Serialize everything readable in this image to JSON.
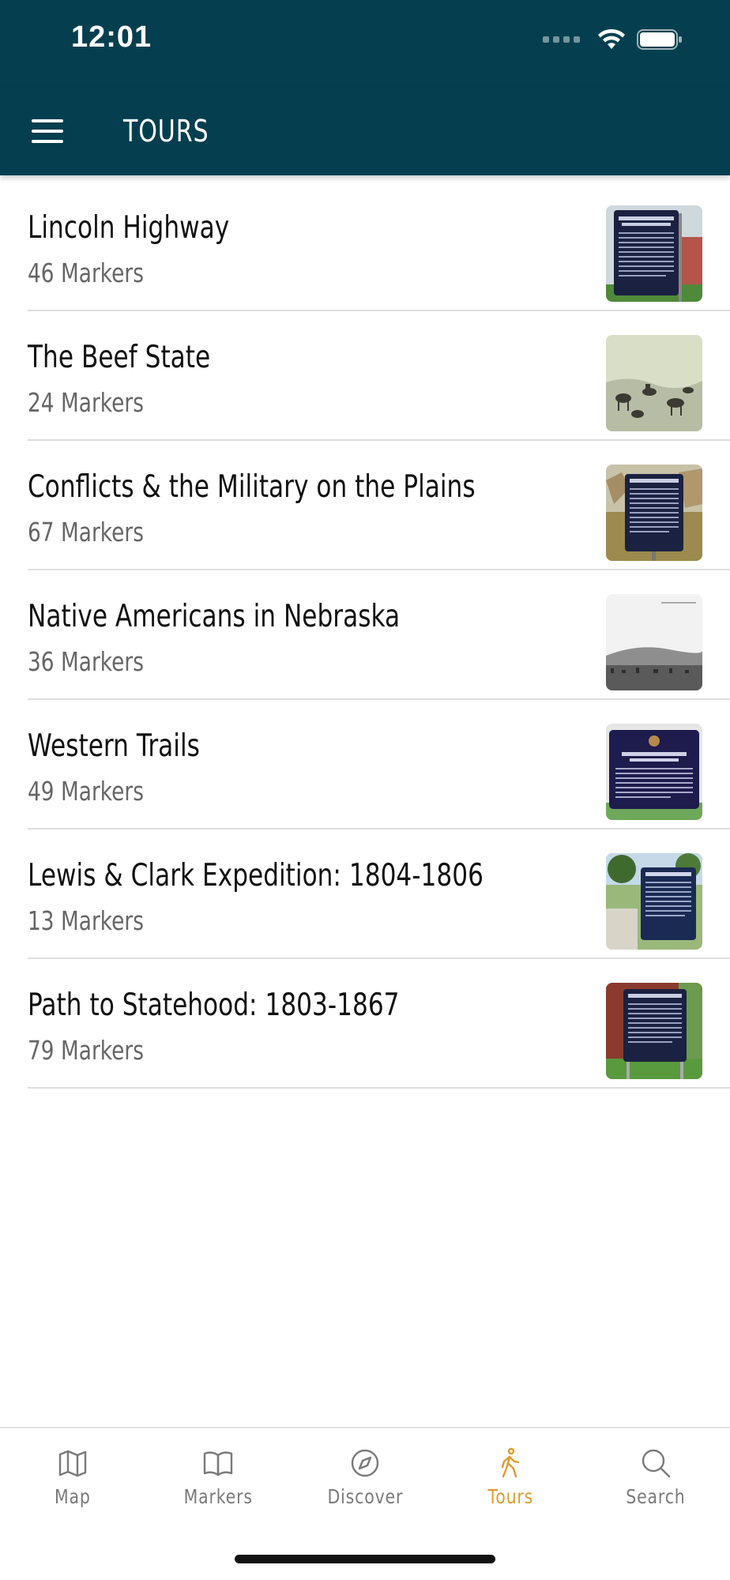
{
  "status_bar": {
    "time": "12:01"
  },
  "header": {
    "title": "TOURS",
    "menu_icon": "hamburger-menu-icon"
  },
  "tours": [
    {
      "name": "Lincoln Highway",
      "count": "46 Markers",
      "thumb": "historical-marker-sign"
    },
    {
      "name": "The Beef State",
      "count": "24 Markers",
      "thumb": "cattle-drive-illustration"
    },
    {
      "name": "Conflicts & the Military on the Plains",
      "count": "67 Markers",
      "thumb": "historical-marker-sign"
    },
    {
      "name": "Native Americans in Nebraska",
      "count": "36 Markers",
      "thumb": "landscape-photo"
    },
    {
      "name": "Western Trails",
      "count": "49 Markers",
      "thumb": "historical-marker-sign"
    },
    {
      "name": "Lewis & Clark Expedition: 1804-1806",
      "count": "13 Markers",
      "thumb": "historical-marker-sign"
    },
    {
      "name": "Path to Statehood: 1803-1867",
      "count": "79 Markers",
      "thumb": "historical-marker-sign"
    }
  ],
  "tab_bar": {
    "tabs": [
      {
        "label": "Map",
        "icon": "map-icon",
        "active": false
      },
      {
        "label": "Markers",
        "icon": "book-icon",
        "active": false
      },
      {
        "label": "Discover",
        "icon": "compass-icon",
        "active": false
      },
      {
        "label": "Tours",
        "icon": "walking-person-icon",
        "active": true
      },
      {
        "label": "Search",
        "icon": "search-icon",
        "active": false
      }
    ]
  },
  "colors": {
    "header_bg": "#053f4f",
    "accent": "#e09a2e",
    "tab_inactive": "#7a7a7a"
  }
}
